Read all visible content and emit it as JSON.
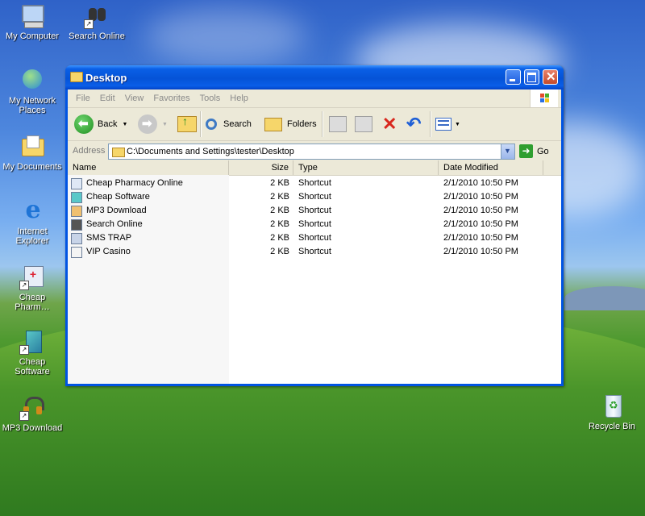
{
  "desktop": {
    "icons": [
      {
        "label": "My Computer",
        "icon": "my-computer-icon"
      },
      {
        "label": "Search Online",
        "icon": "binoculars-icon"
      },
      {
        "label": "My Network Places",
        "icon": "network-places-icon"
      },
      {
        "label": "My Documents",
        "icon": "my-documents-icon"
      },
      {
        "label": "Internet Explorer",
        "icon": "internet-explorer-icon"
      },
      {
        "label": "Cheap Pharm…",
        "icon": "pharmacy-icon"
      },
      {
        "label": "Cheap Software",
        "icon": "software-icon"
      },
      {
        "label": "MP3 Download",
        "icon": "headphones-icon"
      },
      {
        "label": "Recycle Bin",
        "icon": "recycle-bin-icon"
      }
    ]
  },
  "window": {
    "title": "Desktop",
    "menu": [
      "File",
      "Edit",
      "View",
      "Favorites",
      "Tools",
      "Help"
    ],
    "toolbar": {
      "back_label": "Back",
      "search_label": "Search",
      "folders_label": "Folders"
    },
    "address": {
      "label": "Address",
      "value": "C:\\Documents and Settings\\tester\\Desktop",
      "go_label": "Go"
    },
    "columns": [
      "Name",
      "Size",
      "Type",
      "Date Modified"
    ],
    "files": [
      {
        "name": "Cheap Pharmacy Online",
        "size": "2 KB",
        "type": "Shortcut",
        "modified": "2/1/2010 10:50 PM"
      },
      {
        "name": "Cheap Software",
        "size": "2 KB",
        "type": "Shortcut",
        "modified": "2/1/2010 10:50 PM"
      },
      {
        "name": "MP3 Download",
        "size": "2 KB",
        "type": "Shortcut",
        "modified": "2/1/2010 10:50 PM"
      },
      {
        "name": "Search Online",
        "size": "2 KB",
        "type": "Shortcut",
        "modified": "2/1/2010 10:50 PM"
      },
      {
        "name": "SMS TRAP",
        "size": "2 KB",
        "type": "Shortcut",
        "modified": "2/1/2010 10:50 PM"
      },
      {
        "name": "VIP Casino",
        "size": "2 KB",
        "type": "Shortcut",
        "modified": "2/1/2010 10:50 PM"
      }
    ]
  },
  "colors": {
    "titlebar": "#0553d7",
    "close_button": "#c44a2a",
    "window_body": "#ece9d8"
  }
}
